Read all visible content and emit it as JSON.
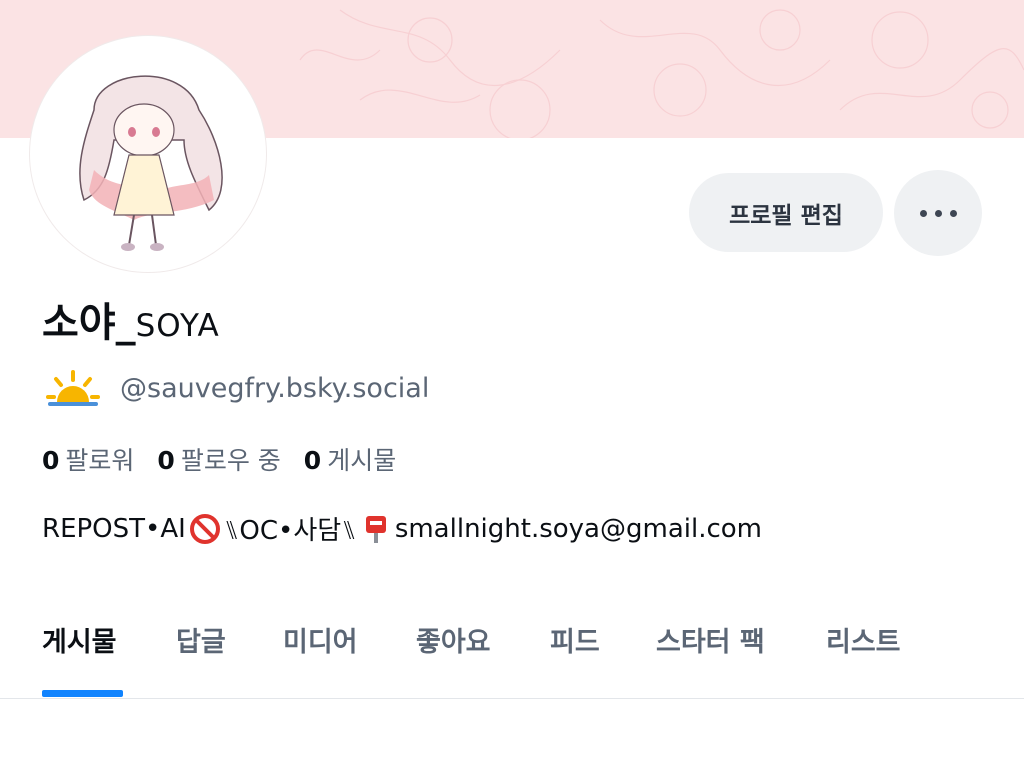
{
  "profile": {
    "display_name_ko": "소야_",
    "display_name_latin": "SOYA",
    "handle": "@sauvegfry.bsky.social",
    "handle_emoji": "sunrise-emoji-icon"
  },
  "actions": {
    "edit_profile_label": "프로필 편집",
    "more_icon": "more-dots-icon"
  },
  "stats": {
    "followers_count": "0",
    "followers_label": "팔로워",
    "following_count": "0",
    "following_label": "팔로우 중",
    "posts_count": "0",
    "posts_label": "게시물"
  },
  "bio": {
    "part1": "REPOST•AI",
    "icon1": "no-entry-icon",
    "part2": "⑊OC•사담⑊",
    "icon2": "mailbox-icon",
    "part3": "smallnight.soya@gmail.com"
  },
  "tabs": [
    {
      "label": "게시물",
      "active": true
    },
    {
      "label": "답글"
    },
    {
      "label": "미디어"
    },
    {
      "label": "좋아요"
    },
    {
      "label": "피드"
    },
    {
      "label": "스타터 팩"
    },
    {
      "label": "리스트"
    }
  ],
  "colors": {
    "banner": "#fbe3e4",
    "accent": "#1083fe",
    "secondary_text": "#5b6675",
    "button_bg": "#eff1f3"
  }
}
